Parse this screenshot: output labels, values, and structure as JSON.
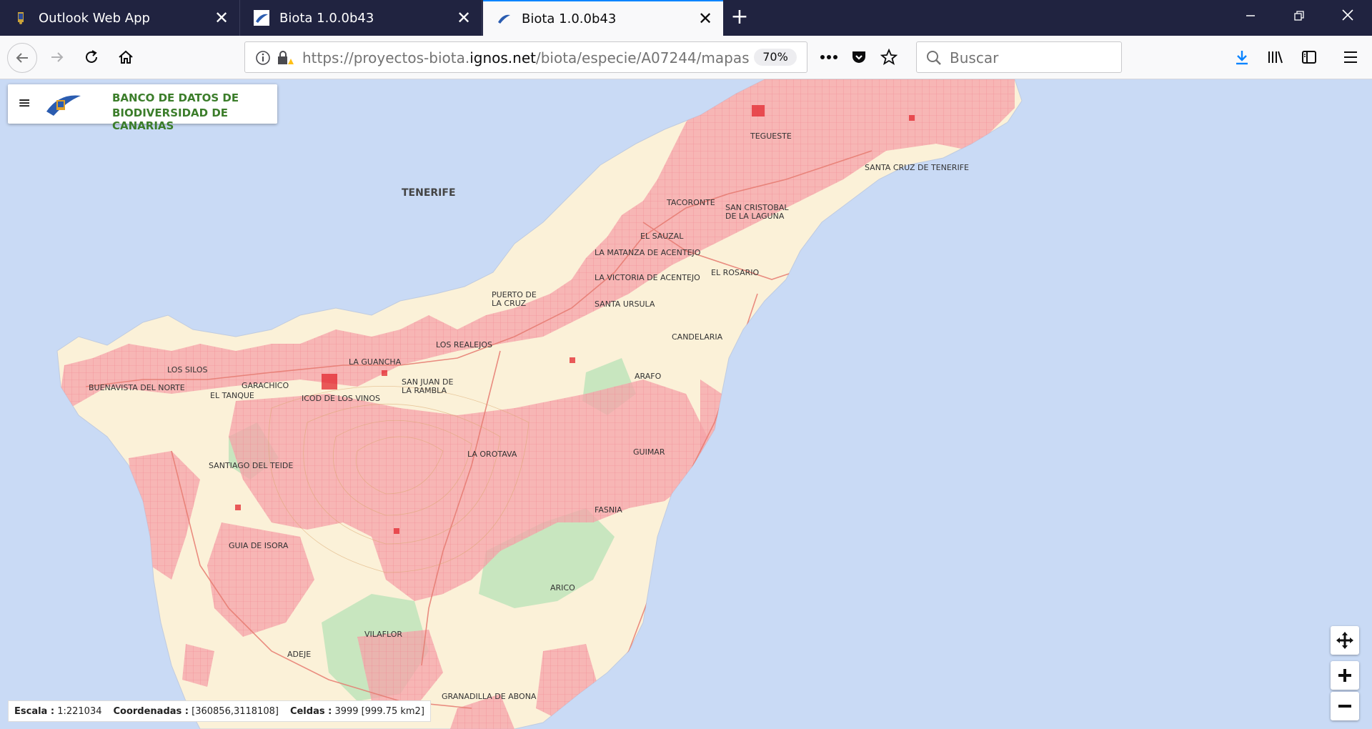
{
  "browser": {
    "tabs": [
      {
        "title": "Outlook Web App",
        "active": false
      },
      {
        "title": "Biota 1.0.0b43",
        "active": false
      },
      {
        "title": "Biota 1.0.0b43",
        "active": true
      }
    ],
    "url": {
      "prefix": "https://proyectos-biota.",
      "host": "ignos.net",
      "path": "/biota/especie/A07244/mapas"
    },
    "zoom": "70%",
    "search_placeholder": "Buscar"
  },
  "app": {
    "title_line1": "BANCO DE DATOS DE",
    "title_line2": "BIODIVERSIDAD DE CANARIAS"
  },
  "map": {
    "island_label": "TENERIFE",
    "places": [
      "TEGUESTE",
      "SANTA CRUZ DE TENERIFE",
      "TACORONTE",
      "SAN CRISTOBAL",
      "DE LA LAGUNA",
      "EL SAUZAL",
      "LA MATANZA DE ACENTEJO",
      "LA VICTORIA DE ACENTEJO",
      "EL ROSARIO",
      "PUERTO DE",
      "LA CRUZ",
      "SANTA URSULA",
      "CANDELARIA",
      "LOS REALEJOS",
      "LA GUANCHA",
      "LOS SILOS",
      "GARACHICO",
      "BUENAVISTA DEL NORTE",
      "EL TANQUE",
      "ICOD DE LOS VINOS",
      "SAN JUAN DE",
      "LA RAMBLA",
      "ARAFO",
      "LA OROTAVA",
      "GUIMAR",
      "SANTIAGO DEL TEIDE",
      "FASNIA",
      "GUIA DE ISORA",
      "ARICO",
      "VILAFLOR",
      "ADEJE",
      "GRANADILLA DE ABONA"
    ],
    "colors": {
      "sea": "#c9daf5",
      "land": "#fbf1d8",
      "forest": "#c8e6bf",
      "cells": "#f5a3a9",
      "cells_dense": "#e3262d",
      "roads": "#e67a70"
    }
  },
  "status": {
    "scale_label": "Escala :",
    "scale_value": "1:221034",
    "coords_label": "Coordenadas :",
    "coords_value": "[360856,3118108]",
    "cells_label": "Celdas :",
    "cells_value": "3999 [999.75 km2]"
  },
  "icons": [
    "back-icon",
    "forward-icon",
    "reload-icon",
    "home-icon",
    "info-icon",
    "lock-warning-icon",
    "more-icon",
    "pocket-icon",
    "star-icon",
    "search-icon",
    "download-icon",
    "library-icon",
    "sidebar-icon",
    "menu-icon",
    "pan-icon",
    "zoom-in-icon",
    "zoom-out-icon"
  ]
}
